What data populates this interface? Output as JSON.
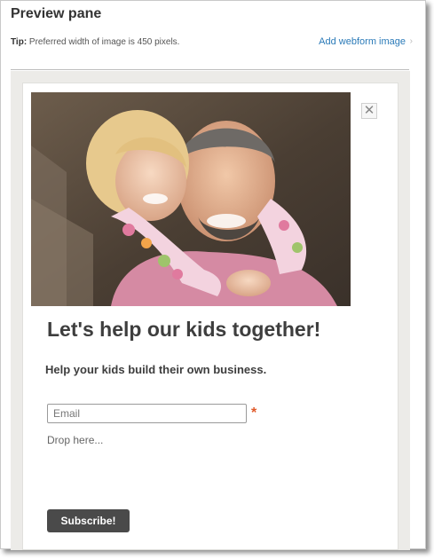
{
  "header": {
    "title": "Preview pane",
    "tip_label": "Tip:",
    "tip_text": " Preferred width of image is 450 pixels.",
    "add_image_link": "Add webform image",
    "add_image_chevron": "›"
  },
  "form": {
    "close_symbol": "✕",
    "headline": "Let's help our kids together!",
    "subheadline": "Help your kids build their own business.",
    "email_placeholder": "Email",
    "email_value": "",
    "required_marker": "*",
    "drop_zone_text": "Drop here...",
    "subscribe_label": "Subscribe!"
  },
  "colors": {
    "link": "#2a7ab8",
    "button_bg": "#4a4a4a",
    "required": "#e05a2a",
    "frame_bg": "#ecebe8"
  }
}
